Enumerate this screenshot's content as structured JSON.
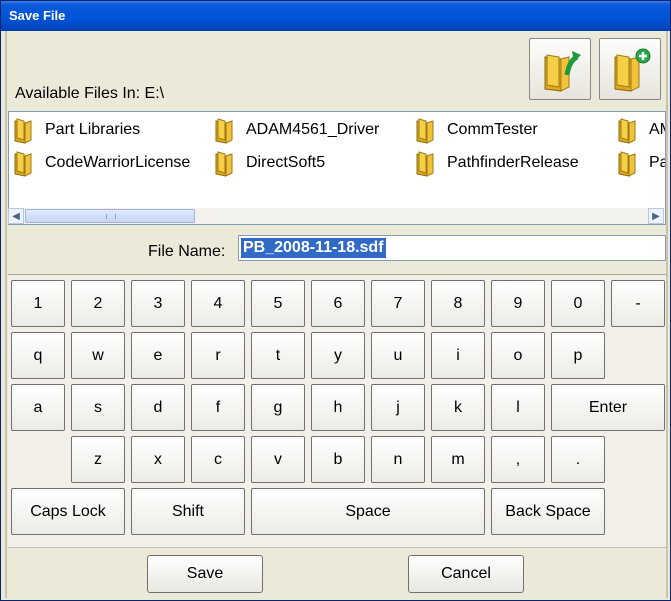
{
  "window": {
    "title": "Save File"
  },
  "toolbar": {
    "up_folder_icon": "folder-up-icon",
    "new_folder_icon": "folder-new-icon"
  },
  "location": {
    "label": "Available Files In: E:\\"
  },
  "files": [
    "Part Libraries",
    "ADAM4561_Driver",
    "CommTester",
    "AM",
    "CodeWarriorLicense",
    "DirectSoft5",
    "PathfinderRelease",
    "Pa"
  ],
  "filename": {
    "label": "File Name:",
    "value": "PB_2008-11-18.sdf"
  },
  "keyboard": {
    "row1": [
      "1",
      "2",
      "3",
      "4",
      "5",
      "6",
      "7",
      "8",
      "9",
      "0",
      "-"
    ],
    "row2": [
      "q",
      "w",
      "e",
      "r",
      "t",
      "y",
      "u",
      "i",
      "o",
      "p"
    ],
    "row3": [
      "a",
      "s",
      "d",
      "f",
      "g",
      "h",
      "j",
      "k",
      "l",
      "Enter"
    ],
    "row4": [
      "z",
      "x",
      "c",
      "v",
      "b",
      "n",
      "m",
      ",",
      "."
    ],
    "row5": [
      "Caps Lock",
      "Shift",
      "Space",
      "Back Space"
    ]
  },
  "actions": {
    "save": "Save",
    "cancel": "Cancel"
  },
  "colors": {
    "titlebar": "#0053d6",
    "selection": "#316ac5",
    "folder": "#f4c430"
  }
}
